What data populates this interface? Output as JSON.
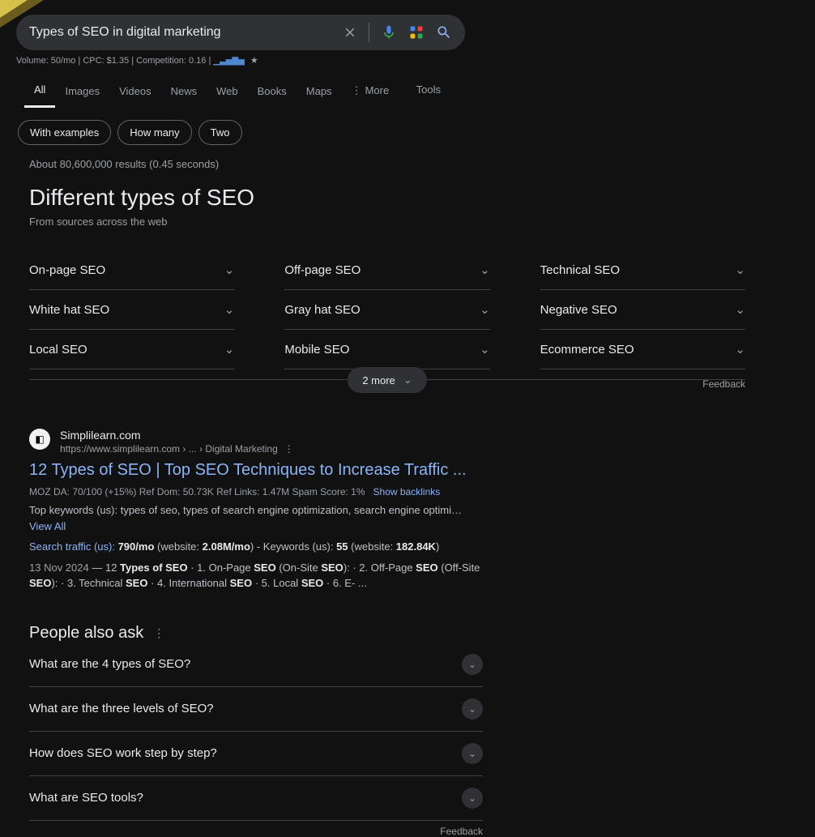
{
  "search": {
    "query": "Types of SEO in digital marketing"
  },
  "seo_bar": "Volume: 50/mo | CPC: $1.35 | Competition: 0.16 |",
  "tabs": [
    "All",
    "Images",
    "Videos",
    "News",
    "Web",
    "Books",
    "Maps",
    "More"
  ],
  "tools_label": "Tools",
  "chips": [
    "With examples",
    "How many",
    "Two"
  ],
  "results_stats": "About 80,600,000 results (0.45 seconds)",
  "hero": {
    "title": "Different types of SEO",
    "sub": "From sources across the web"
  },
  "grid": [
    "On-page SEO",
    "Off-page SEO",
    "Technical SEO",
    "White hat SEO",
    "Gray hat SEO",
    "Negative SEO",
    "Local SEO",
    "Mobile SEO",
    "Ecommerce SEO"
  ],
  "more_button": "2 more",
  "feedback_label": "Feedback",
  "result": {
    "site": "Simplilearn.com",
    "url": "https://www.simplilearn.com › ... › Digital Marketing",
    "title": "12 Types of SEO | Top SEO Techniques to Increase Traffic ...",
    "metrics": "MOZ DA: 70/100 (+15%)   Ref Dom: 50.73K   Ref Links: 1.47M   Spam Score: 1%",
    "backlinks": "Show backlinks",
    "topkw": "Top keywords (us): types of seo, types of search engine optimization, search engine optimi…",
    "viewall": "View All",
    "traffic_a": "Search traffic (us): ",
    "traffic_b": "790/mo",
    "traffic_c": " (website: ",
    "traffic_d": "2.08M/mo",
    "traffic_e": ") - Keywords (us): ",
    "traffic_f": "55",
    "traffic_g": " (website: ",
    "traffic_h": "182.84K",
    "traffic_i": ")",
    "date": "13 Nov 2024",
    "snippet_pre": " — 12 ",
    "snippet_b1": "Types of SEO",
    "snippet_mid1": " · 1. On-Page ",
    "snippet_b2": "SEO",
    "snippet_mid2": " (On-Site ",
    "snippet_b3": "SEO",
    "snippet_mid3": "): · 2. Off-Page ",
    "snippet_b4": "SEO",
    "snippet_mid4": " (Off-Site ",
    "snippet_b5": "SEO",
    "snippet_mid5": "): · 3. Technical ",
    "snippet_b6": "SEO",
    "snippet_mid6": " · 4. International ",
    "snippet_b7": "SEO",
    "snippet_mid7": " · 5. Local ",
    "snippet_b8": "SEO",
    "snippet_mid8": " · 6. E- ..."
  },
  "paa": {
    "title": "People also ask",
    "items": [
      "What are the 4 types of SEO?",
      "What are the three levels of SEO?",
      "How does SEO work step by step?",
      "What are SEO tools?"
    ]
  }
}
